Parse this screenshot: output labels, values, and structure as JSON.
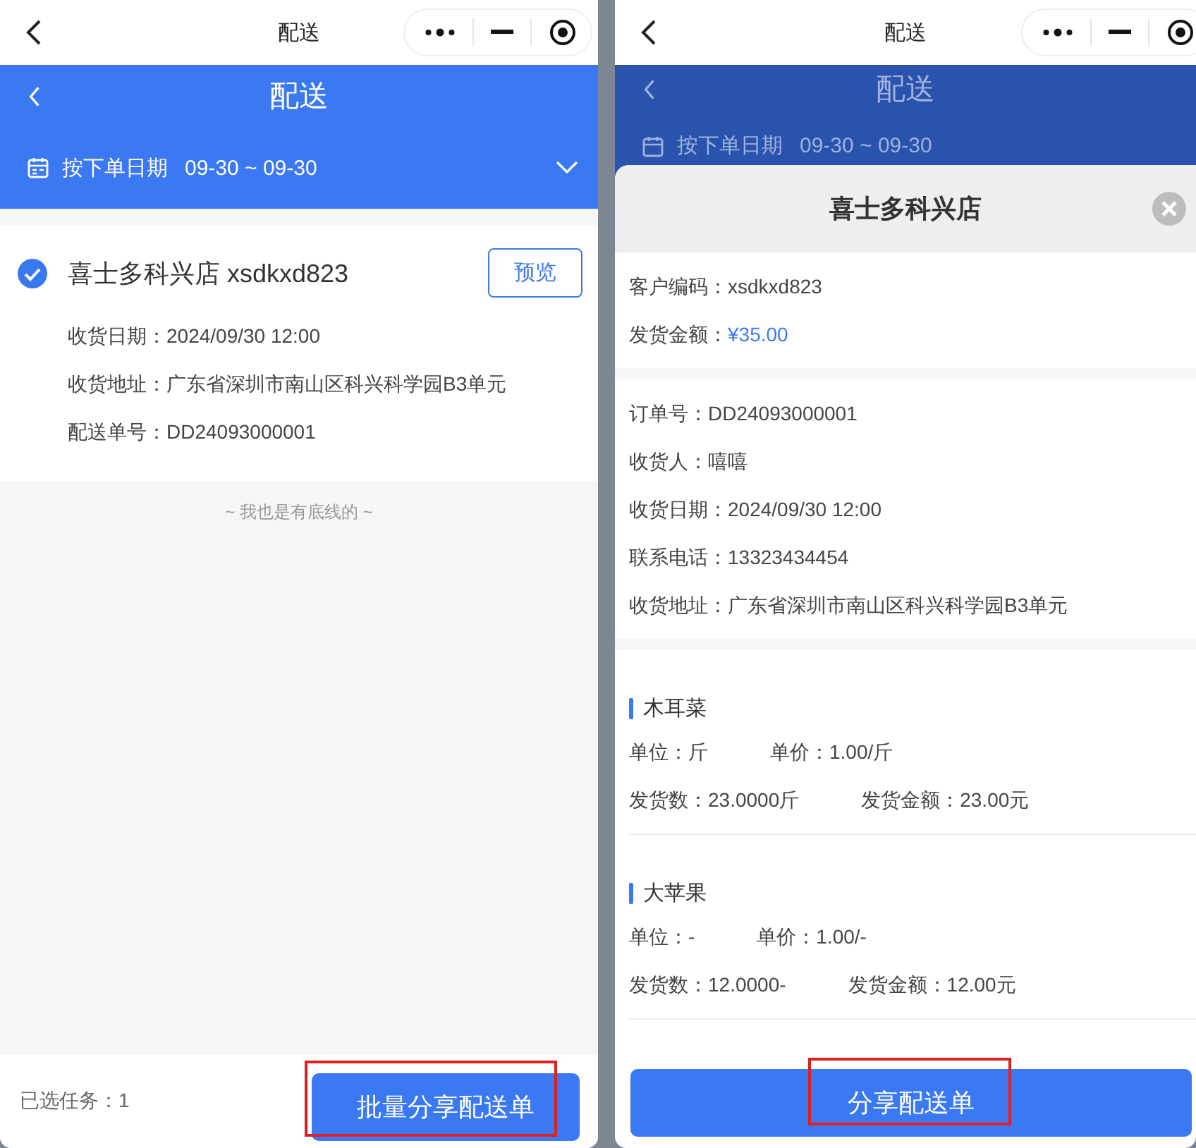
{
  "left": {
    "topbar": {
      "title": "配送"
    },
    "header": {
      "title": "配送",
      "filter_label": "按下单日期",
      "date_range": "09-30 ~ 09-30"
    },
    "order": {
      "checked": true,
      "store": "喜士多科兴店 xsdkxd823",
      "preview_button": "预览",
      "fields": [
        {
          "label": "收货日期：",
          "value": "2024/09/30 12:00"
        },
        {
          "label": "收货地址：",
          "value": "广东省深圳市南山区科兴科学园B3单元"
        },
        {
          "label": "配送单号：",
          "value": "DD24093000001"
        }
      ]
    },
    "end_note": "~ 我也是有底线的 ~",
    "footer": {
      "selected_label": "已选任务：",
      "selected_count": "1",
      "button": {
        "label": "批量分享配送单",
        "highlighted": true
      }
    }
  },
  "right": {
    "topbar": {
      "title": "配送"
    },
    "header": {
      "title": "配送",
      "filter_label": "按下单日期",
      "date_range": "09-30 ~ 09-30"
    },
    "modal": {
      "title": "喜士多科兴店",
      "summary": [
        {
          "label": "客户编码：",
          "value": "xsdkxd823",
          "kind": "plain"
        },
        {
          "label": "发货金额：",
          "value": "¥35.00",
          "kind": "amount"
        }
      ],
      "details": [
        {
          "label": "订单号：",
          "value": "DD24093000001"
        },
        {
          "label": "收货人：",
          "value": "嘻嘻"
        },
        {
          "label": "收货日期：",
          "value": "2024/09/30 12:00"
        },
        {
          "label": "联系电话：",
          "value": "13323434454"
        },
        {
          "label": "收货地址：",
          "value": "广东省深圳市南山区科兴科学园B3单元"
        }
      ],
      "items": [
        {
          "name": "木耳菜",
          "rows": [
            [
              "单位：斤",
              "单价：1.00/斤"
            ],
            [
              "发货数：23.0000斤",
              "发货金额：23.00元"
            ]
          ]
        },
        {
          "name": "大苹果",
          "rows": [
            [
              "单位：-",
              "单价：1.00/-"
            ],
            [
              "发货数：12.0000-",
              "发货金额：12.00元"
            ]
          ]
        }
      ],
      "button": {
        "label": "分享配送单",
        "highlighted": true
      }
    }
  }
}
